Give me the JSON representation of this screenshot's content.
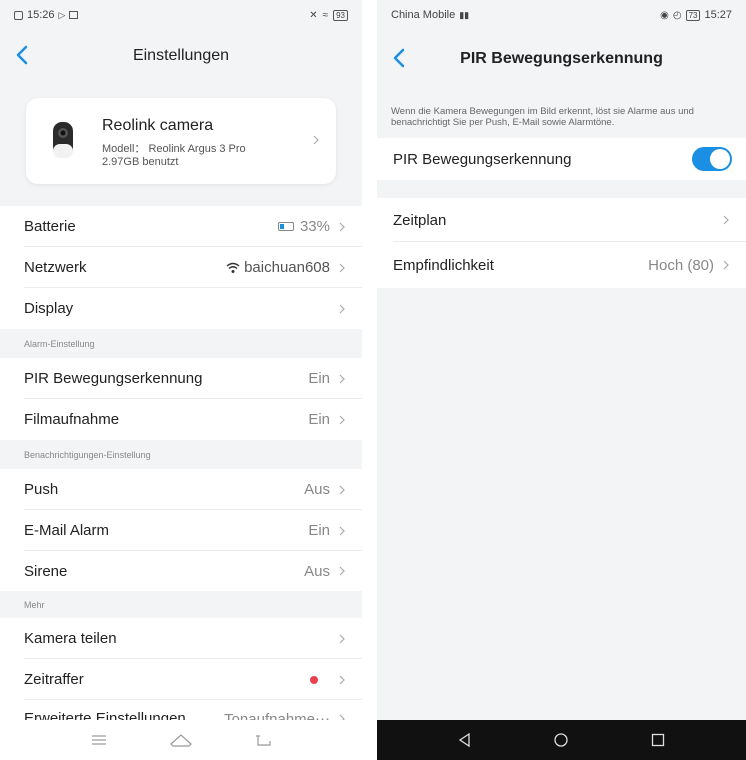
{
  "left": {
    "status": {
      "time": "15:26",
      "battery": "93"
    },
    "nav": {
      "title": "Einstellungen"
    },
    "camera": {
      "name": "Reolink camera",
      "model": "Modell： Reolink Argus 3 Pro",
      "usage": "2.97GB benutzt"
    },
    "rows": {
      "battery": {
        "label": "Batterie",
        "value": "33%"
      },
      "network": {
        "label": "Netzwerk",
        "value": "baichuan608"
      },
      "display": {
        "label": "Display"
      },
      "alarm_section": "Alarm-Einstellung",
      "pir": {
        "label": "PIR Bewegungserkennung",
        "value": "Ein"
      },
      "recording": {
        "label": "Filmaufnahme",
        "value": "Ein"
      },
      "notif_section": "Benachrichtigungen-Einstellung",
      "push": {
        "label": "Push",
        "value": "Aus"
      },
      "email": {
        "label": "E-Mail Alarm",
        "value": "Ein"
      },
      "siren": {
        "label": "Sirene",
        "value": "Aus"
      },
      "more_section": "Mehr",
      "share": {
        "label": "Kamera teilen"
      },
      "timelapse": {
        "label": "Zeitraffer"
      },
      "advanced": {
        "label": "Erweiterte Einstellungen",
        "value": "Tonaufnahme⋯"
      }
    }
  },
  "right": {
    "status": {
      "carrier": "China Mobile",
      "battery": "73",
      "time": "15:27"
    },
    "nav": {
      "title": "PIR Bewegungserkennung"
    },
    "description": "Wenn die Kamera Bewegungen im Bild erkennt, löst sie Alarme aus und benachrichtigt Sie per Push, E-Mail sowie Alarmtöne.",
    "pir_toggle": {
      "label": "PIR Bewegungserkennung",
      "on": true
    },
    "schedule": {
      "label": "Zeitplan"
    },
    "sensitivity": {
      "label": "Empfindlichkeit",
      "value": "Hoch (80)"
    }
  },
  "colors": {
    "accent": "#1a8fe3",
    "dot": "#e8414f"
  }
}
